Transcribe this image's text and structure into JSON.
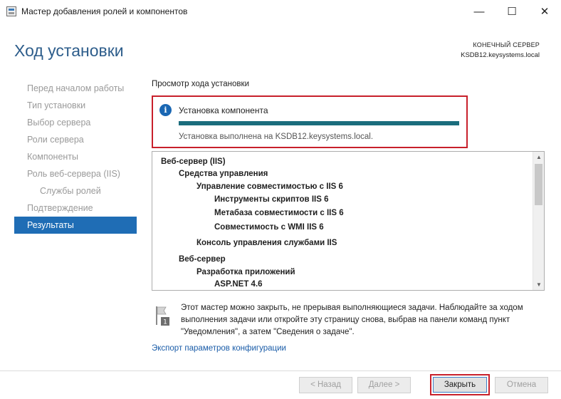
{
  "window": {
    "title": "Мастер добавления ролей и компонентов",
    "minimize_glyph": "—",
    "maximize_glyph": "☐",
    "close_glyph": "✕"
  },
  "header": {
    "page_title": "Ход установки",
    "server_caption": "КОНЕЧНЫЙ СЕРВЕР",
    "server_name": "KSDB12.keysystems.local"
  },
  "sidebar": {
    "items": [
      {
        "label": "Перед началом работы"
      },
      {
        "label": "Тип установки"
      },
      {
        "label": "Выбор сервера"
      },
      {
        "label": "Роли сервера"
      },
      {
        "label": "Компоненты"
      },
      {
        "label": "Роль веб-сервера (IIS)"
      },
      {
        "label": "Службы ролей"
      },
      {
        "label": "Подтверждение"
      },
      {
        "label": "Результаты"
      }
    ]
  },
  "main": {
    "section_label": "Просмотр хода установки",
    "progress": {
      "title": "Установка компонента",
      "value_percent": 100,
      "status": "Установка выполнена на KSDB12.keysystems.local."
    },
    "results": [
      {
        "text": "Веб-сервер (IIS)"
      },
      {
        "text": "Средства управления"
      },
      {
        "text": "Управление совместимостью с IIS 6"
      },
      {
        "text": "Инструменты скриптов IIS 6"
      },
      {
        "text": "Метабаза совместимости с IIS 6"
      },
      {
        "text": "Совместимость с WMI IIS 6"
      },
      {
        "text": "Консоль управления службами IIS"
      },
      {
        "text": "Веб-сервер"
      },
      {
        "text": "Разработка приложений"
      },
      {
        "text": "ASP.NET 4.6"
      }
    ],
    "note": "Этот мастер можно закрыть, не прерывая выполняющиеся задачи. Наблюдайте за ходом выполнения задачи или откройте эту страницу снова, выбрав на панели команд пункт \"Уведомления\", а затем \"Сведения о задаче\".",
    "export_link": "Экспорт параметров конфигурации"
  },
  "footer": {
    "back_label": "< Назад",
    "next_label": "Далее >",
    "close_label": "Закрыть",
    "cancel_label": "Отмена"
  },
  "colors": {
    "accent": "#1f6db5",
    "progress": "#1b6d7d",
    "highlight": "#c8202b"
  },
  "icons": {
    "info": "info-icon",
    "note": "flag-notification-icon"
  }
}
